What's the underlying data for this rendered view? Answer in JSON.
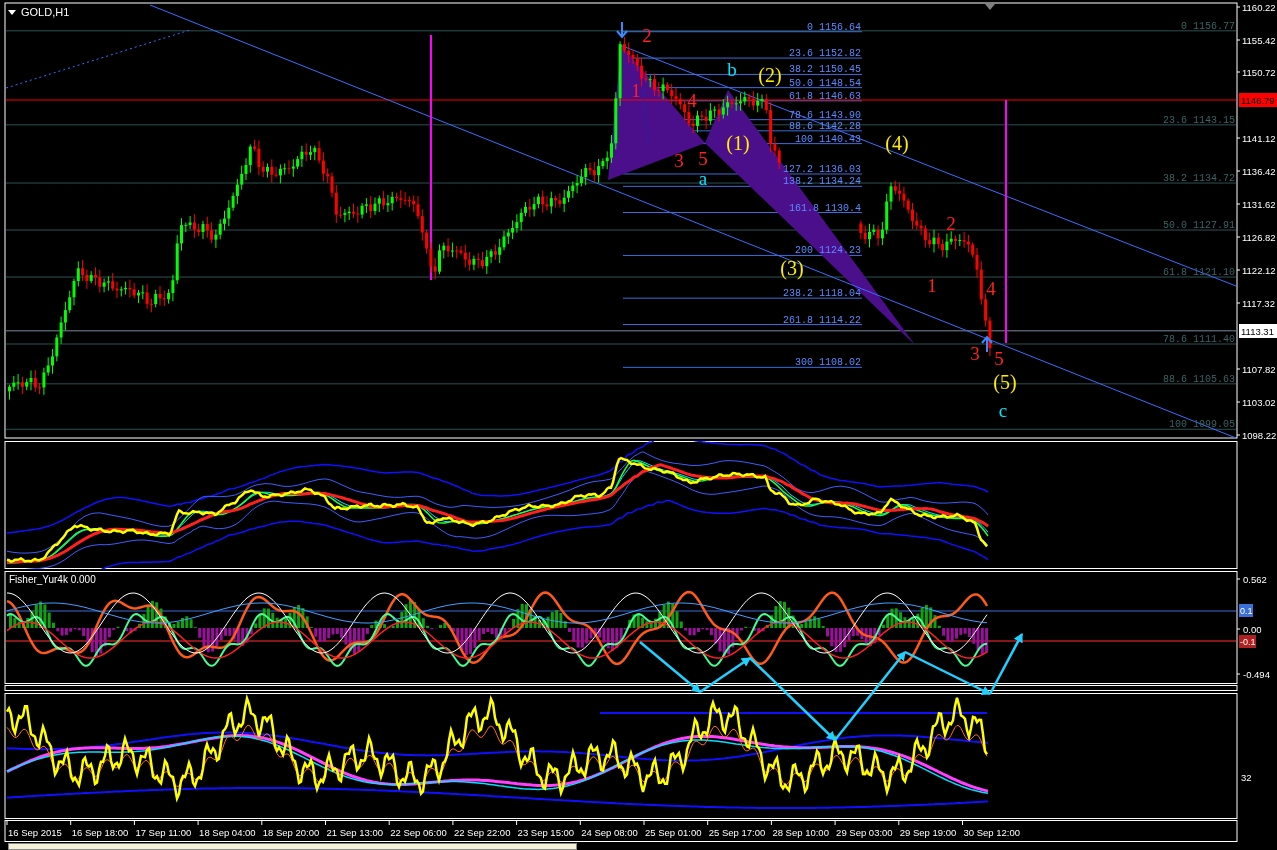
{
  "chart": {
    "title": "GOLD,H1",
    "price_axis": [
      "1160.22",
      "1155.42",
      "1150.72",
      "1141.12",
      "1136.42",
      "1131.62",
      "1126.82",
      "1122.12",
      "1117.32",
      "1107.82",
      "1103.02",
      "1098.22"
    ],
    "line_price": "1146.79",
    "current_price": "1113.31",
    "fib_extension": [
      "0 1156.64",
      "23.6 1152.82",
      "38.2 1150.45",
      "50.0 1148.54",
      "61.8 1146.63",
      "78.6 1143.90",
      "88.6 1142.28",
      "100 1140.43",
      "127.2 1136.03",
      "138.2 1134.24",
      "161.8 1130.4",
      "200 1124.23",
      "238.2 1118.04",
      "261.8 1114.22",
      "300 1108.02"
    ],
    "fib_retracement": [
      "0 1156.77",
      "23.6 1143.15",
      "38.2 1134.72",
      "50.0 1127.91",
      "61.8 1121.10",
      "78.6 1111.40",
      "88.6 1105.63",
      "100 1099.05"
    ],
    "wave_labels": [
      {
        "text": "2",
        "color": "#ff2020"
      },
      {
        "text": "1",
        "color": "#ff2020"
      },
      {
        "text": "4",
        "color": "#ff2020"
      },
      {
        "text": "3",
        "color": "#ff2020"
      },
      {
        "text": "5",
        "color": "#ff2020"
      },
      {
        "text": "b",
        "color": "#00e5ff"
      },
      {
        "text": "a",
        "color": "#00e5ff"
      },
      {
        "text": "(2)",
        "color": "#ffee00"
      },
      {
        "text": "(1)",
        "color": "#ffee00"
      },
      {
        "text": "(4)",
        "color": "#ffee00"
      },
      {
        "text": "(3)",
        "color": "#ffee00"
      },
      {
        "text": "2",
        "color": "#ff2020"
      },
      {
        "text": "1",
        "color": "#ff2020"
      },
      {
        "text": "4",
        "color": "#ff2020"
      },
      {
        "text": "3",
        "color": "#ff2020"
      },
      {
        "text": "5",
        "color": "#ff2020"
      },
      {
        "text": "(5)",
        "color": "#ffee00"
      },
      {
        "text": "c",
        "color": "#00e5ff"
      }
    ]
  },
  "fisher": {
    "title": "Fisher_Yur4k 0.000",
    "axis": [
      "0.562",
      "0.00",
      "-0.494"
    ],
    "upper_level": "0.1",
    "lower_level": "-0.1"
  },
  "oscillator": {
    "axis": [
      "32"
    ]
  },
  "time_axis": [
    "16 Sep 2015",
    "16 Sep 18:00",
    "17 Sep 11:00",
    "18 Sep 04:00",
    "18 Sep 20:00",
    "21 Sep 13:00",
    "22 Sep 06:00",
    "22 Sep 22:00",
    "23 Sep 15:00",
    "24 Sep 08:00",
    "25 Sep 01:00",
    "25 Sep 17:00",
    "28 Sep 10:00",
    "29 Sep 03:00",
    "29 Sep 19:00",
    "30 Sep 12:00"
  ]
}
